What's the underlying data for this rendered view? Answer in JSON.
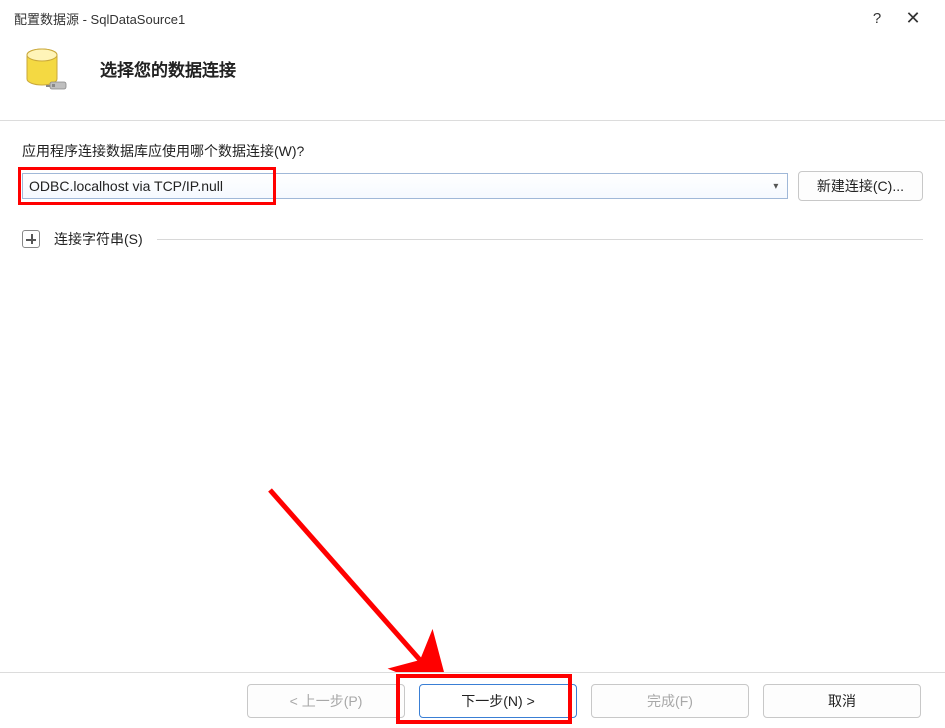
{
  "titlebar": {
    "title": "配置数据源 - SqlDataSource1"
  },
  "header": {
    "heading": "选择您的数据连接"
  },
  "content": {
    "prompt": "应用程序连接数据库应使用哪个数据连接(W)?",
    "selected_connection": "ODBC.localhost via TCP/IP.null",
    "new_connection_label": "新建连接(C)...",
    "expand_label": "连接字符串(S)"
  },
  "footer": {
    "back": "< 上一步(P)",
    "next": "下一步(N) >",
    "finish": "完成(F)",
    "cancel": "取消"
  }
}
